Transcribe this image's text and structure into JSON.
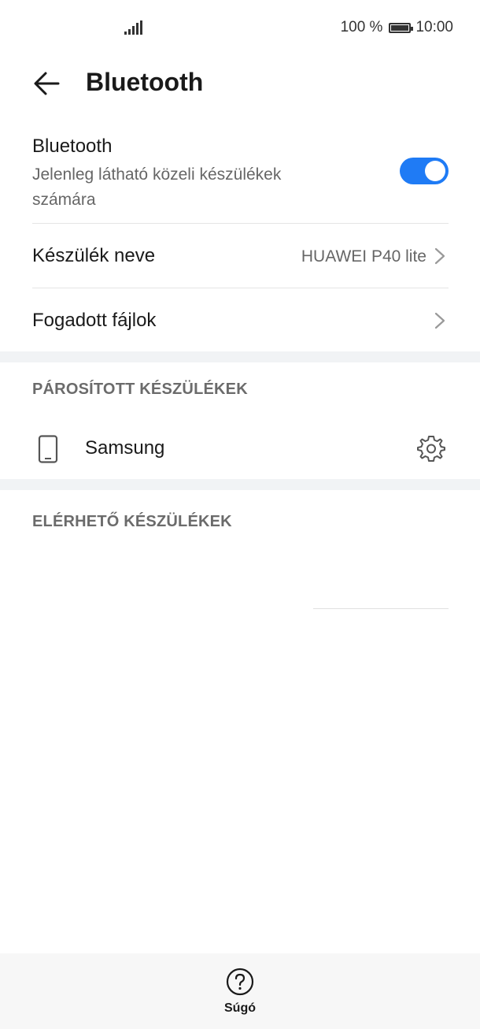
{
  "status_bar": {
    "battery_percent": "100 %",
    "time": "10:00",
    "icons": [
      "signal-icon",
      "battery-icon"
    ]
  },
  "header": {
    "title": "Bluetooth",
    "back_icon": "back-arrow-icon"
  },
  "bluetooth_toggle": {
    "label": "Bluetooth",
    "subtitle": "Jelenleg látható közeli készülékek számára",
    "enabled": true,
    "accent_color": "#1f7bf5"
  },
  "device_name": {
    "label": "Készülék neve",
    "value": "HUAWEI P40 lite"
  },
  "received_files": {
    "label": "Fogadott fájlok"
  },
  "paired_section": {
    "title": "PÁROSÍTOTT KÉSZÜLÉKEK",
    "devices": [
      {
        "name": "Samsung",
        "icon": "phone-icon",
        "action_icon": "gear-icon"
      }
    ]
  },
  "available_section": {
    "title": "ELÉRHETŐ KÉSZÜLÉKEK"
  },
  "bottom_bar": {
    "help_label": "Súgó",
    "help_icon": "question-icon"
  }
}
